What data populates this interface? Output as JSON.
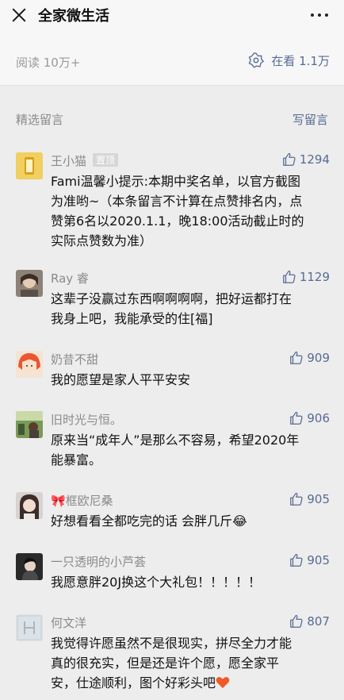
{
  "header": {
    "title": "全家微生活"
  },
  "stats": {
    "read_label": "阅读 10万+",
    "watching_label": "在看 1.1万"
  },
  "section": {
    "title": "精选留言",
    "write": "写留言"
  },
  "comments": [
    {
      "name": "王小猫",
      "pin": "置顶",
      "likes": "1294",
      "lines": [
        "Fami温馨小提示:本期中奖名单，以官方截图",
        "为准哟~（本条留言不计算在点赞排名内，点",
        "赞第6名以2020.1.1，晚18:00活动截止时的",
        "实际点赞数为准）"
      ]
    },
    {
      "name": "Ray 睿",
      "likes": "1129",
      "lines": [
        "这辈子没赢过东西啊啊啊啊，把好运都打在",
        "我身上吧，我能承受的住[福]"
      ]
    },
    {
      "name": "奶昔不甜",
      "likes": "909",
      "lines": [
        "我的愿望是家人平平安安"
      ]
    },
    {
      "name": "旧时光与恒。",
      "likes": "906",
      "lines": [
        "原来当“成年人”是那么不容易，希望2020年",
        "能暴富。"
      ]
    },
    {
      "name": "🎀框欧尼桑",
      "likes": "905",
      "lines": [
        "好想看看全都吃完的话 会胖几斤😂"
      ]
    },
    {
      "name": "一只透明的小芦荟",
      "likes": "905",
      "lines": [
        "我愿意胖20J换这个大礼包！！！！！"
      ]
    },
    {
      "name": "何文洋",
      "likes": "807",
      "lines": [
        "我觉得许愿虽然不是很现实，拼尽全力才能",
        "真的很充实，但是还是许个愿，愿全家平",
        "安，仕途顺利，图个好彩头吧"
      ]
    }
  ]
}
